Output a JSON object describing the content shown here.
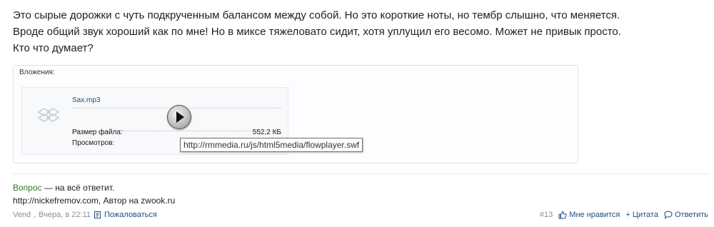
{
  "post": {
    "lines": [
      "Это сырые дорожки с чуть подкрученным балансом между собой. Но это короткие ноты, но тембр слышно, что меняется.",
      "Вроде общий звук хороший как по мне! Но в миксе тяжеловато сидит, хотя уплущил его весомо. Может не привык просто.",
      "Кто что думает?"
    ]
  },
  "attachments": {
    "title": "Вложения:",
    "file": {
      "name": "Sax.mp3",
      "size_label": "Размер файла:",
      "size_value": "552,2 КБ",
      "views_label": "Просмотров:",
      "views_value": ""
    },
    "icon": "dropbox-icon"
  },
  "tooltip": "http://rmmedia.ru/js/html5media/flowplayer.swf",
  "signature": {
    "green_text": "Вопрос",
    "rest_text": " — на всё ответит.",
    "line2": "http://nickefremov.com, Автор на zwook.ru"
  },
  "footer": {
    "author": "Vend",
    "date": "Вчера, в 22:11",
    "report": "Пожаловаться",
    "post_number": "#13",
    "like": "Мне нравится",
    "quote": "+ Цитата",
    "reply": "Ответить"
  },
  "colors": {
    "link": "#1f4f86",
    "green": "#2f7a1f",
    "muted": "#8a8f96"
  }
}
